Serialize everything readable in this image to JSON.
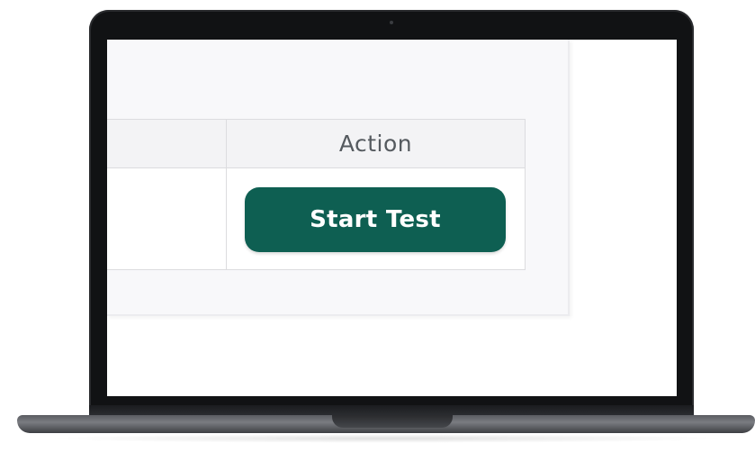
{
  "table": {
    "header": {
      "action": "Action"
    },
    "rows": [
      {
        "action_button": "Start Test"
      }
    ]
  },
  "colors": {
    "accent": "#0e5f52",
    "header_bg": "#f3f3f5",
    "header_text": "#555a5f",
    "bezel": "#111214"
  }
}
